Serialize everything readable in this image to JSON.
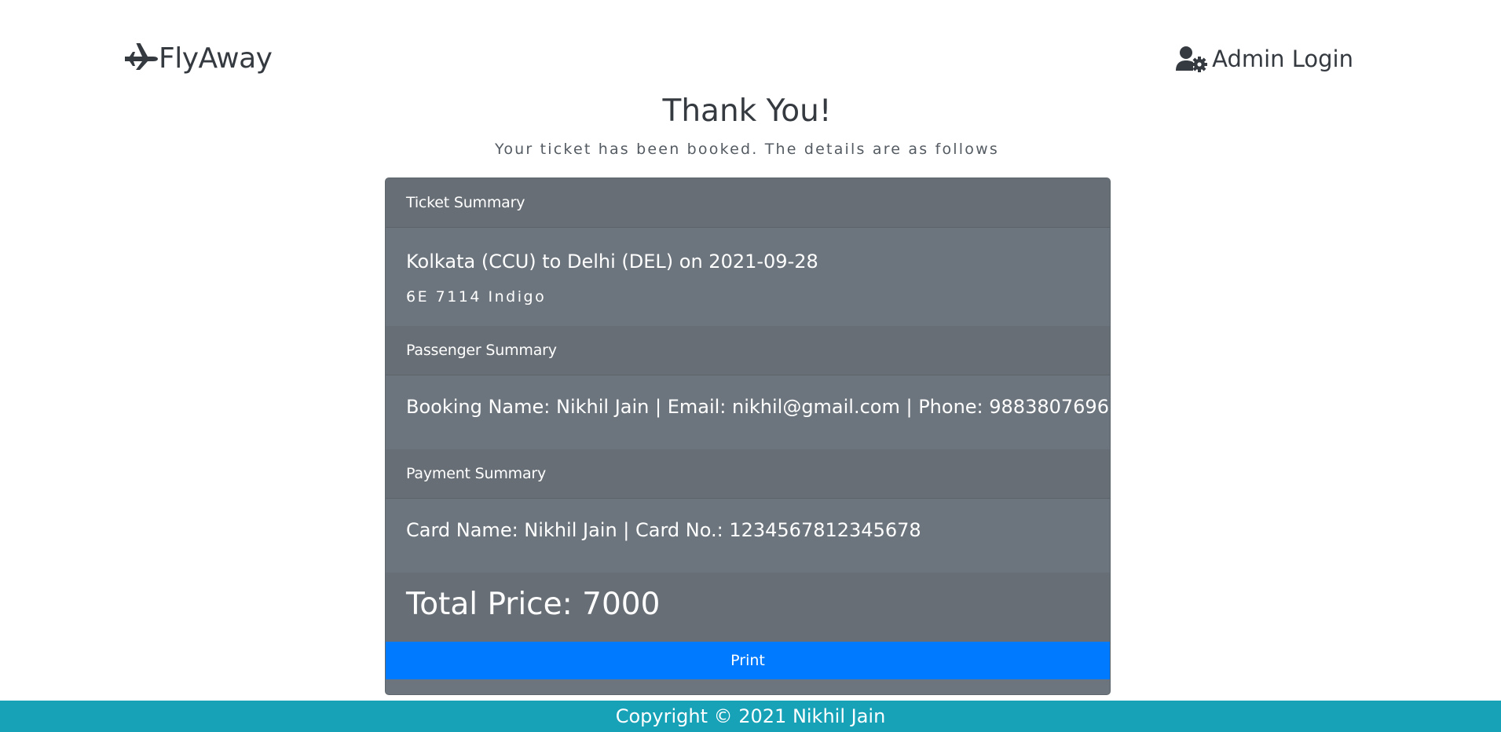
{
  "header": {
    "brand": "FlyAway",
    "brand_icon": "plane-icon",
    "admin_link": "Admin Login",
    "admin_icon": "user-cog-icon"
  },
  "confirmation": {
    "title": "Thank You!",
    "subtitle": "Your ticket has been booked. The details are as follows"
  },
  "ticket_summary": {
    "header": "Ticket Summary",
    "route": "Kolkata (CCU) to Delhi (DEL) on 2021-09-28",
    "flight": "6E 7114 Indigo"
  },
  "passenger_summary": {
    "header": "Passenger Summary",
    "details": "Booking Name: Nikhil Jain | Email: nikhil@gmail.com | Phone: 9883807696"
  },
  "payment_summary": {
    "header": "Payment Summary",
    "details": "Card Name: Nikhil Jain | Card No.: 1234567812345678"
  },
  "total": {
    "label": "Total Price: 7000"
  },
  "actions": {
    "print_label": "Print"
  },
  "footer": {
    "copyright": "Copyright © 2021 Nikhil Jain"
  },
  "colors": {
    "card_bg": "#6c757d",
    "print_button": "#007bff",
    "footer_bg": "#17a2b8",
    "text_dark": "#343a40"
  }
}
